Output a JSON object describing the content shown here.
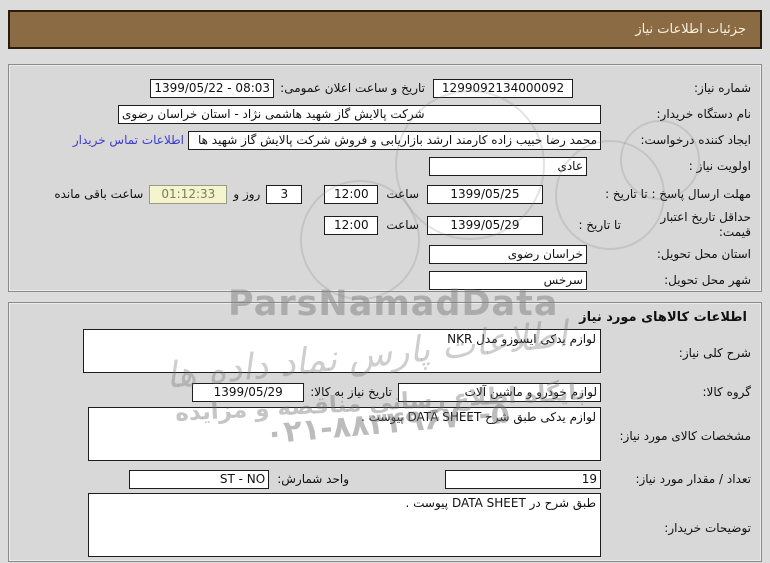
{
  "title_bar": "جزئیات اطلاعات نیاز",
  "panel1": {
    "need_number_label": "شماره نیاز:",
    "need_number_value": "1299092134000092",
    "announce_datetime_label": "تاریخ و ساعت اعلان عمومی:",
    "announce_datetime_value": "1399/05/22 - 08:03",
    "buyer_org_label": "نام دستگاه خریدار:",
    "buyer_org_value": "شرکت پالایش گاز شهید هاشمی نژاد - استان خراسان رضوی",
    "creator_label": "ایجاد کننده درخواست:",
    "creator_value": "محمد رضا حبیب زاده کارمند ارشد بازاریابی و فروش شرکت پالایش گاز شهید ها",
    "contact_link": "اطلاعات تماس خریدار",
    "priority_label": "اولویت نیاز :",
    "priority_value": "عادی",
    "deadline_label": "مهلت ارسال پاسخ : تا تاریخ :",
    "deadline_date": "1399/05/25",
    "hour_label": "ساعت",
    "deadline_time": "12:00",
    "days_value": "3",
    "days_and_label": "روز و",
    "countdown_value": "01:12:33",
    "countdown_suffix": "ساعت باقی مانده",
    "price_validity_label": "حداقل تاریخ اعتبار قیمت:",
    "until_date_label": "تا تاریخ :",
    "price_validity_date": "1399/05/29",
    "price_validity_time": "12:00",
    "province_label": "استان محل تحویل:",
    "province_value": "خراسان رضوی",
    "city_label": "شهر محل تحویل:",
    "city_value": "سرخس"
  },
  "panel2": {
    "header": "اطلاعات کالاهای مورد نیاز",
    "desc_label": "شرح کلی نیاز:",
    "desc_value": "لوازم یدکی ایسوزو مدل NKR",
    "group_label": "گروه کالا:",
    "group_value": "لوازم خودرو و ماشین آلات",
    "need_date_label": "تاریخ نیاز به کالا:",
    "need_date_value": "1399/05/29",
    "specs_label": "مشخصات کالای مورد نیاز:",
    "specs_value": "لوازم یدکی طبق شرح DATA SHEET  پیوست .",
    "qty_label": "تعداد / مقدار مورد نیاز:",
    "qty_value": "19",
    "unit_label": "واحد شمارش:",
    "unit_value": "ST - NO",
    "buyer_notes_label": "توضیحات خریدار:",
    "buyer_notes_value": "طبق شرح در DATA SHEET   پیوست ."
  },
  "watermarks": {
    "brand": "ParsNamadData",
    "script_text": "اطلاعات پارس نماد داده ها",
    "info_text": "پایگاه اطلاع رسانی مناقصه و مزایده",
    "phone": "۰۲۱-۸۸۳۴۹۶۷۰-۵"
  },
  "colors": {
    "titlebar_bg": "#8b6b44",
    "titlebar_border": "#2a1b0b",
    "countdown_bg": "#f4f4cd",
    "link": "#3c3ccf",
    "page_bg": "#dcdcdc"
  }
}
